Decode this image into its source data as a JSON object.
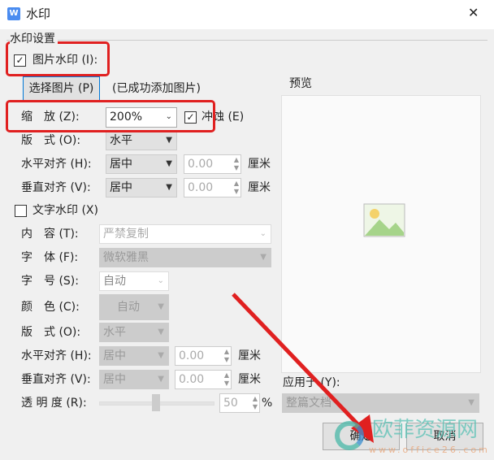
{
  "window": {
    "title": "水印",
    "close": "✕"
  },
  "group": "水印设置",
  "picture": {
    "checkbox_label": "图片水印 (I):",
    "checked": true,
    "select_button": "选择图片 (P)",
    "status": "(已成功添加图片)",
    "scale_label": "缩　放 (Z):",
    "scale_value": "200%",
    "washout_label": "冲蚀 (E)",
    "washout_checked": true,
    "layout_label": "版　式 (O):",
    "layout_value": "水平",
    "halign_label": "水平对齐 (H):",
    "halign_value": "居中",
    "halign_offset": "0.00",
    "valign_label": "垂直对齐 (V):",
    "valign_value": "居中",
    "valign_offset": "0.00",
    "unit": "厘米"
  },
  "text": {
    "checkbox_label": "文字水印 (X)",
    "checked": false,
    "content_label": "内　容 (T):",
    "content_value": "严禁复制",
    "font_label": "字　体 (F):",
    "font_value": "微软雅黑",
    "size_label": "字　号 (S):",
    "size_value": "自动",
    "color_label": "颜　色 (C):",
    "color_value": "自动",
    "layout_label": "版　式 (O):",
    "layout_value": "水平",
    "halign_label": "水平对齐 (H):",
    "halign_value": "居中",
    "halign_offset": "0.00",
    "valign_label": "垂直对齐 (V):",
    "valign_value": "居中",
    "valign_offset": "0.00",
    "unit": "厘米",
    "opacity_label": "透 明 度 (R):",
    "opacity_value": "50",
    "opacity_unit": "%",
    "opacity_percent": 50
  },
  "preview": {
    "label": "预览"
  },
  "apply": {
    "label": "应用于 (Y):",
    "value": "整篇文档"
  },
  "buttons": {
    "ok": "确定",
    "cancel": "取消"
  },
  "watermark_logo": {
    "text": "欧菲资源网",
    "url": "www.office26.com"
  },
  "colors": {
    "highlight": "#e02020",
    "accent": "#0078d7"
  }
}
